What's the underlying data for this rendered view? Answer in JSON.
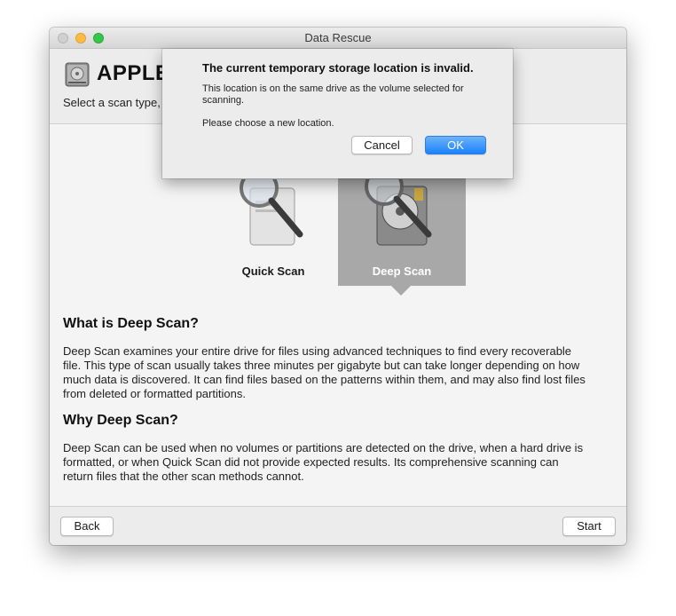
{
  "window": {
    "title": "Data Rescue",
    "drive_name": "APPLE",
    "subtitle": "Select a scan type,"
  },
  "scan_options": [
    {
      "label": "Quick Scan",
      "selected": false,
      "icon": "magnifier-hard-drive-icon"
    },
    {
      "label": "Deep Scan",
      "selected": true,
      "icon": "magnifier-open-hard-drive-icon"
    }
  ],
  "info": {
    "what_heading": "What is Deep Scan?",
    "what_lines": [
      "Deep Scan examines your entire drive for files using advanced techniques to find every recoverable",
      "file. This type of scan usually takes three minutes per gigabyte but can take longer depending on how",
      "much data is discovered. It can find files based on the patterns within them, and may also find lost files",
      "from deleted or formatted partitions."
    ],
    "why_heading": "Why Deep Scan?",
    "why_lines": [
      "Deep Scan can be used when no volumes or partitions are detected on the drive, when a hard drive is",
      "formatted, or when Quick Scan did not provide expected results. Its comprehensive scanning can",
      "return files that the other scan methods cannot."
    ]
  },
  "footer": {
    "back_label": "Back",
    "start_label": "Start"
  },
  "dialog": {
    "title": "The current temporary storage location is invalid.",
    "message_lines": [
      "This location is on the same drive as the volume selected for",
      "scanning."
    ],
    "message2": "Please choose a new location.",
    "cancel_label": "Cancel",
    "ok_label": "OK"
  },
  "colors": {
    "accent": "#1a82fb",
    "selected_tile": "#a8a8a8"
  }
}
